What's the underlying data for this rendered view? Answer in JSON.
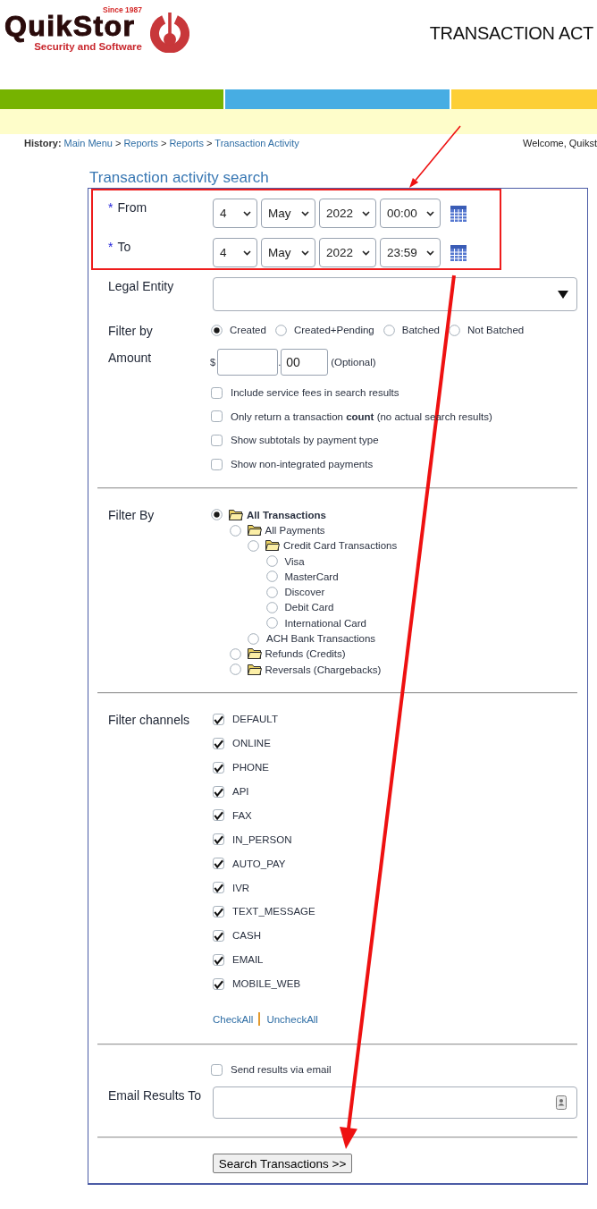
{
  "header": {
    "logo": {
      "wordmark": "QuikStor",
      "since": "Since 1987",
      "tagline": "Security and Software"
    },
    "title": "TRANSACTION ACT"
  },
  "nav_bar": [
    {
      "color": "#76b300"
    },
    {
      "color": "#47ade3"
    },
    {
      "color": "#fdcf36"
    }
  ],
  "breadcrumb": {
    "label": "History:",
    "items": [
      "Main Menu",
      "Reports",
      "Reports",
      "Transaction Activity"
    ],
    "separators": [
      ">",
      ">",
      ">"
    ]
  },
  "welcome": "Welcome, Quikst",
  "form": {
    "heading": "Transaction activity search",
    "date_range": [
      {
        "required_mark": "*",
        "label": "From",
        "day": "4",
        "month": "May",
        "year": "2022",
        "time": "00:00"
      },
      {
        "required_mark": "*",
        "label": "To",
        "day": "4",
        "month": "May",
        "year": "2022",
        "time": "23:59"
      }
    ],
    "legal_entity": {
      "label": "Legal Entity"
    },
    "status_filter": {
      "label": "Filter by",
      "options": [
        {
          "label": "Created",
          "selected": true
        },
        {
          "label": "Created+Pending",
          "selected": false
        },
        {
          "label": "Batched",
          "selected": false
        },
        {
          "label": "Not Batched",
          "selected": false
        }
      ]
    },
    "amount": {
      "label": "Amount",
      "currency": "$",
      "decimal_point": ".",
      "cents": "00",
      "hint": "(Optional)"
    },
    "options": [
      {
        "label": "Include service fees in search results",
        "checked": false
      },
      {
        "label": "Only return a transaction **count** (no actual search results)",
        "checked": false
      },
      {
        "label": "Show subtotals by payment type",
        "checked": false
      },
      {
        "label": "Show non-integrated payments",
        "checked": false
      }
    ],
    "transaction_filter": {
      "label": "Filter By",
      "tree": [
        {
          "label": "All Transactions",
          "kind": "folder",
          "selected": true,
          "children": [
            {
              "label": "All Payments",
              "kind": "folder",
              "selected": false,
              "children": [
                {
                  "label": "Credit Card Transactions",
                  "kind": "folder",
                  "selected": false,
                  "children": [
                    {
                      "label": "Visa",
                      "kind": "item",
                      "selected": false
                    },
                    {
                      "label": "MasterCard",
                      "kind": "item",
                      "selected": false
                    },
                    {
                      "label": "Discover",
                      "kind": "item",
                      "selected": false
                    },
                    {
                      "label": "Debit Card",
                      "kind": "item",
                      "selected": false
                    },
                    {
                      "label": "International Card",
                      "kind": "item",
                      "selected": false
                    }
                  ]
                },
                {
                  "label": "ACH Bank Transactions",
                  "kind": "item",
                  "selected": false
                }
              ]
            },
            {
              "label": "Refunds (Credits)",
              "kind": "folder",
              "selected": false
            },
            {
              "label": "Reversals (Chargebacks)",
              "kind": "folder",
              "selected": false
            }
          ]
        }
      ]
    },
    "channels": {
      "label": "Filter channels",
      "items": [
        {
          "label": "DEFAULT",
          "checked": true
        },
        {
          "label": "ONLINE",
          "checked": true
        },
        {
          "label": "PHONE",
          "checked": true
        },
        {
          "label": "API",
          "checked": true
        },
        {
          "label": "FAX",
          "checked": true
        },
        {
          "label": "IN_PERSON",
          "checked": true
        },
        {
          "label": "AUTO_PAY",
          "checked": true
        },
        {
          "label": "IVR",
          "checked": true
        },
        {
          "label": "TEXT_MESSAGE",
          "checked": true
        },
        {
          "label": "CASH",
          "checked": true
        },
        {
          "label": "EMAIL",
          "checked": true
        },
        {
          "label": "MOBILE_WEB",
          "checked": true
        }
      ],
      "check_all": "CheckAll",
      "uncheck_all": "UncheckAll"
    },
    "email": {
      "send": {
        "label": "Send results via email",
        "checked": false
      },
      "label": "Email Results To"
    },
    "search_button": "Search Transactions >>"
  },
  "annotations": {
    "box_around_dates": true,
    "arrow_to_box": true,
    "arrow_to_search_button": true
  }
}
